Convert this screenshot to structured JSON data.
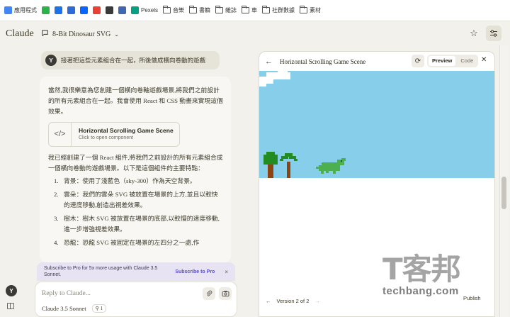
{
  "bookmarks": [
    {
      "label": "應用程式",
      "icon": "apps-grid-icon",
      "color": "#4285f4"
    },
    {
      "label": "",
      "icon": "bookmark-green-icon",
      "color": "#2bb34a"
    },
    {
      "label": "",
      "icon": "bookmark-blue-icon",
      "color": "#1a73e8"
    },
    {
      "label": "",
      "icon": "bookmark-c-icon",
      "color": "#2f6bd8"
    },
    {
      "label": "",
      "icon": "bookmark-meta-icon",
      "color": "#0866ff"
    },
    {
      "label": "",
      "icon": "bookmark-trend-icon",
      "color": "#e94235"
    },
    {
      "label": "",
      "icon": "bookmark-s-icon",
      "color": "#3a3a3a"
    },
    {
      "label": "",
      "icon": "bookmark-fb-icon",
      "color": "#4267b2"
    },
    {
      "label": "Pexels",
      "icon": "pexels-icon",
      "color": "#05a081"
    },
    {
      "label": "音樂",
      "icon": "folder-icon"
    },
    {
      "label": "書籍",
      "icon": "folder-icon"
    },
    {
      "label": "雜誌",
      "icon": "folder-icon"
    },
    {
      "label": "車",
      "icon": "folder-icon"
    },
    {
      "label": "社群數據",
      "icon": "folder-icon"
    },
    {
      "label": "素材",
      "icon": "folder-icon"
    }
  ],
  "header": {
    "logo": "Claude",
    "conversation_title": "8-Bit Dinosaur SVG"
  },
  "chat": {
    "user_avatar": "Y",
    "user_message": "接著把這些元素組合在一起，所後做成橫向卷動的遊戲",
    "intro": "當然,我很樂意為您創建一個橫向卷軸遊戲場景,將我們之前設計的所有元素組合在一起。我會使用 React 和 CSS 動畫來實現這個效果。",
    "artifact_card": {
      "title": "Horizontal Scrolling Game Scene",
      "subtitle": "Click to open component"
    },
    "summary": "我已經創建了一個 React 組件,將我們之前設計的所有元素組合成一個橫向卷動的遊戲場景。以下是這個組件的主要特點：",
    "features": [
      {
        "num": "1.",
        "text": "背景：使用了淺藍色（sky-300）作為天空背景。"
      },
      {
        "num": "2.",
        "text": "雲朵：我們的雲朵 SVG 被放置在場景的上方,並且以較快的速度移動,創造出視差效果。"
      },
      {
        "num": "3.",
        "text": "樹木：樹木 SVG 被放置在場景的底部,以較慢的速度移動,進一步增強視差效果。"
      },
      {
        "num": "4.",
        "text": "恐龍：恐龍 SVG 被固定在場景的左四分之一處,作"
      }
    ]
  },
  "promo": {
    "text": "Subscribe to Pro for 5x more usage with Claude 3.5 Sonnet.",
    "link": "Subscribe to Pro",
    "close": "×"
  },
  "composer": {
    "placeholder": "Reply to Claude...",
    "model": "Claude 3.5 Sonnet",
    "project_count": "1"
  },
  "sidebar": {
    "avatar": "Y"
  },
  "artifact_panel": {
    "title": "Horizontal Scrolling Game Scene",
    "tabs": {
      "preview": "Preview",
      "code": "Code"
    },
    "version": "Version 2 of 2",
    "publish": "Publish",
    "colors": {
      "sky": "#87ceeb",
      "tree_trunk": "#8b4513",
      "tree_leaves": "#228b22",
      "dino": "#4caf50"
    }
  },
  "watermark": {
    "big": "T客邦",
    "small": "techbang.com"
  }
}
